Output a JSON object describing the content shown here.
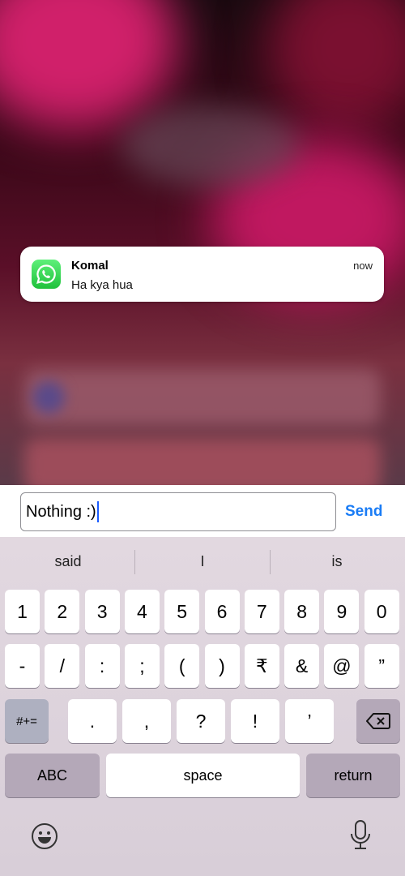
{
  "notification": {
    "app_icon": "whatsapp-icon",
    "sender": "Komal",
    "message": "Ha kya hua",
    "time": "now"
  },
  "reply": {
    "value": "Nothing :)",
    "send_label": "Send",
    "accent": "#1a7cf5"
  },
  "suggestions": [
    "said",
    "I",
    "is"
  ],
  "keyboard": {
    "row1": [
      "1",
      "2",
      "3",
      "4",
      "5",
      "6",
      "7",
      "8",
      "9",
      "0"
    ],
    "row2": [
      "-",
      "/",
      ":",
      ";",
      "(",
      ")",
      "₹",
      "&",
      "@",
      "”"
    ],
    "row3": [
      ".",
      ",",
      "?",
      "!",
      "’"
    ],
    "more_symbols": "#+=",
    "delete_icon": "backspace-icon",
    "abc": "ABC",
    "space": "space",
    "return": "return",
    "emoji_icon": "emoji-icon",
    "mic_icon": "microphone-icon"
  }
}
